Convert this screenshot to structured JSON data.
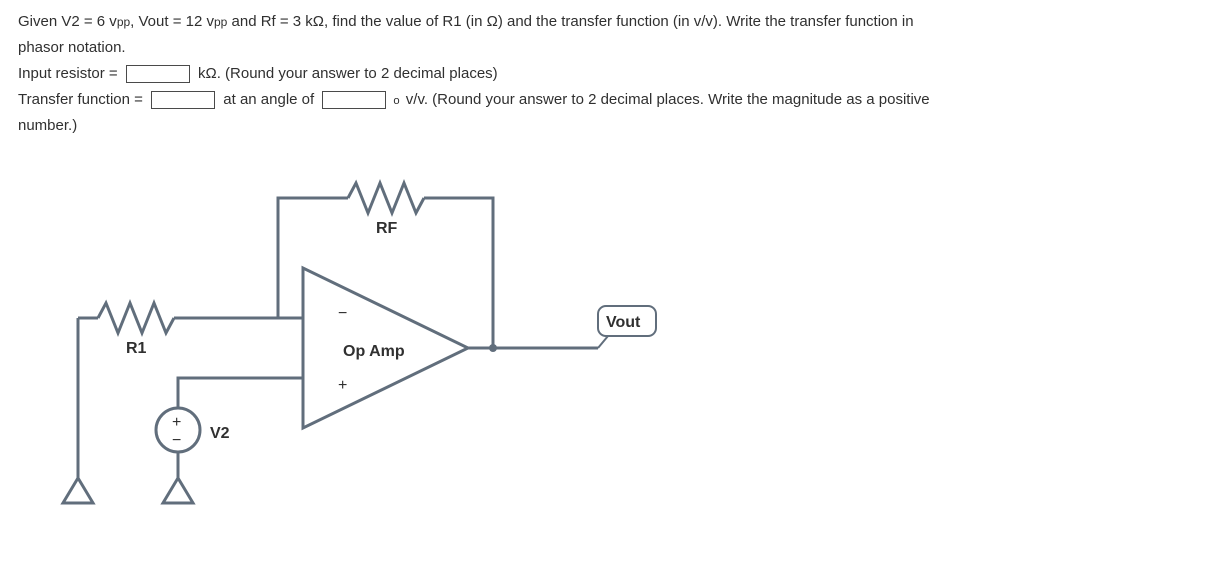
{
  "question": {
    "line1_part1": "Given V2 = 6 v",
    "line1_sub1": "pp",
    "line1_part2": ", Vout = 12 v",
    "line1_sub2": "pp",
    "line1_part3": " and Rf = 3 kΩ, find the value of R1 (in Ω) and the transfer function (in v/v). Write the transfer function in",
    "line2": "phasor notation.",
    "input_resistor_label": "Input resistor = ",
    "input_resistor_suffix": " kΩ. (Round your answer to 2 decimal places)",
    "transfer_function_label": "Transfer function = ",
    "transfer_mid": " at an angle of ",
    "transfer_suffix": " v/v. (Round your answer to 2 decimal places. Write the magnitude as a positive",
    "line5": "number.)"
  },
  "inputs": {
    "resistor_value": "",
    "magnitude_value": "",
    "angle_value": ""
  },
  "diagram": {
    "rf_label": "RF",
    "r1_label": "R1",
    "v2_label": "V2",
    "opamp_label": "Op Amp",
    "minus": "−",
    "plus": "+",
    "src_plus": "+",
    "src_minus": "−",
    "vout_label": "Vout"
  }
}
